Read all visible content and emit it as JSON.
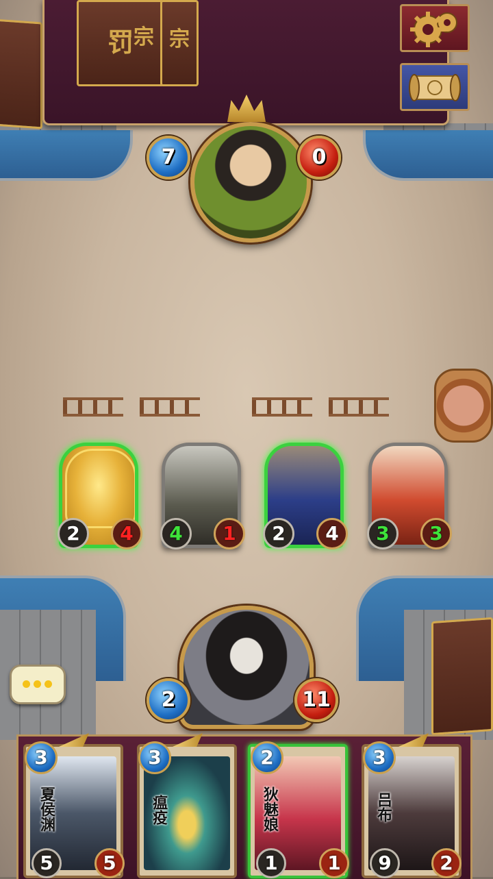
{
  "opponent_panel": {
    "deck_glyph_1": "罚",
    "deck_glyph_2": "宗",
    "deck_glyph_3": "宗"
  },
  "buttons": {
    "settings_icon": "gear-icon",
    "scroll_icon": "scroll-icon",
    "chat_icon": "chat-bubble-icon"
  },
  "opponent_hero": {
    "mana": "7",
    "hp": "0"
  },
  "player_hero": {
    "mana": "2",
    "hp": "11"
  },
  "board": {
    "minions": [
      {
        "attack": "2",
        "health": "4",
        "attack_color": "white",
        "health_color": "red",
        "ready": true,
        "shielded": true
      },
      {
        "attack": "4",
        "health": "1",
        "attack_color": "green",
        "health_color": "red",
        "ready": false,
        "shielded": false
      },
      {
        "attack": "2",
        "health": "4",
        "attack_color": "white",
        "health_color": "white",
        "ready": true,
        "shielded": false
      },
      {
        "attack": "3",
        "health": "3",
        "attack_color": "green",
        "health_color": "green",
        "ready": false,
        "shielded": false
      }
    ]
  },
  "hand": {
    "cards": [
      {
        "name": "夏侯渊",
        "cost": "3",
        "attack": "5",
        "health": "5",
        "playable": false,
        "winged": true
      },
      {
        "name": "瘟疫",
        "cost": "3",
        "attack": "",
        "health": "",
        "playable": false,
        "winged": true
      },
      {
        "name": "狄魅娘",
        "cost": "2",
        "attack": "1",
        "health": "1",
        "playable": true,
        "winged": false
      },
      {
        "name": "吕布",
        "cost": "3",
        "attack": "9",
        "health": "2",
        "playable": false,
        "winged": true
      }
    ]
  },
  "colors": {
    "ready_glow": "#3bd13f",
    "mana_blue": "#1f6fc4",
    "health_red": "#c51f10",
    "panel_maroon": "#4b1c33",
    "gold_trim": "#c9a26b"
  }
}
